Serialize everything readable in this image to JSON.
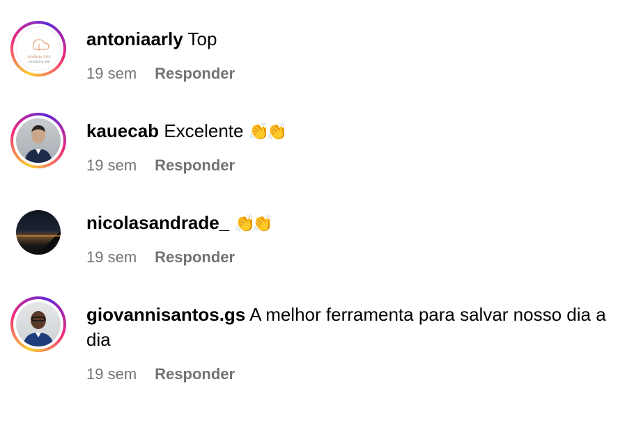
{
  "comments": [
    {
      "username": "antoniaarly",
      "text": "Top",
      "time": "19 sem",
      "reply_label": "Responder",
      "avatar": {
        "type": "logo",
        "brand": "Antônia Arly",
        "tagline": "consultoria web"
      }
    },
    {
      "username": "kauecab",
      "text": "Excelente",
      "emoji": "👏👏",
      "time": "19 sem",
      "reply_label": "Responder",
      "avatar": {
        "type": "photo"
      }
    },
    {
      "username": "nicolasandrade_",
      "text": "",
      "emoji": "👏👏",
      "time": "19 sem",
      "reply_label": "Responder",
      "avatar": {
        "type": "photo"
      }
    },
    {
      "username": "giovannisantos.gs",
      "text": "A melhor ferramenta para salvar nosso dia a dia",
      "time": "19 sem",
      "reply_label": "Responder",
      "avatar": {
        "type": "photo"
      }
    }
  ],
  "colors": {
    "meta_text": "#737373",
    "story_ring": [
      "#f9ce34",
      "#ee2a7b",
      "#6228d7"
    ]
  }
}
